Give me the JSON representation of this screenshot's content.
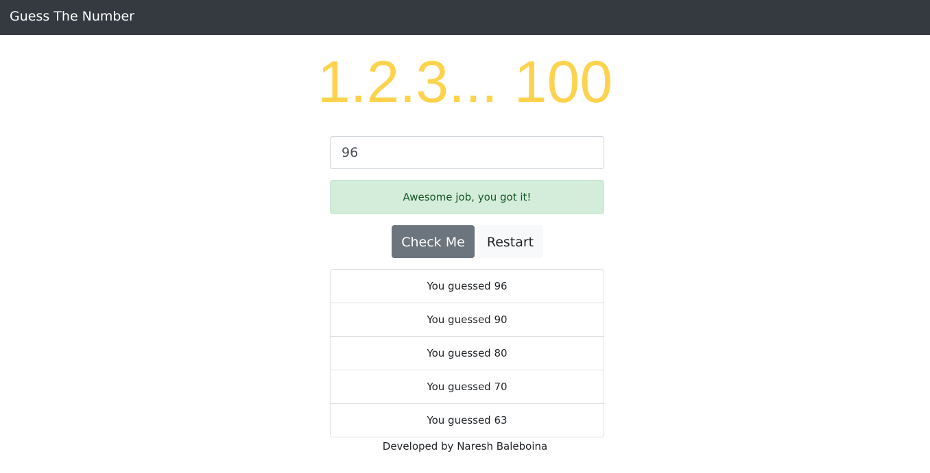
{
  "navbar": {
    "brand": "Guess The Number",
    "background": "#343a40"
  },
  "hero": {
    "title": "1.2.3... 100",
    "color": "#fdd34d"
  },
  "guess_input": {
    "value": "96"
  },
  "alert": {
    "message": "Awesome job, you got it!",
    "variant": "success"
  },
  "buttons": {
    "check_label": "Check Me",
    "restart_label": "Restart"
  },
  "guesses": [
    {
      "label": "You guessed 96"
    },
    {
      "label": "You guessed 90"
    },
    {
      "label": "You guessed 80"
    },
    {
      "label": "You guessed 70"
    },
    {
      "label": "You guessed 63"
    }
  ],
  "footer": {
    "text": "Developed by Naresh Baleboina"
  }
}
